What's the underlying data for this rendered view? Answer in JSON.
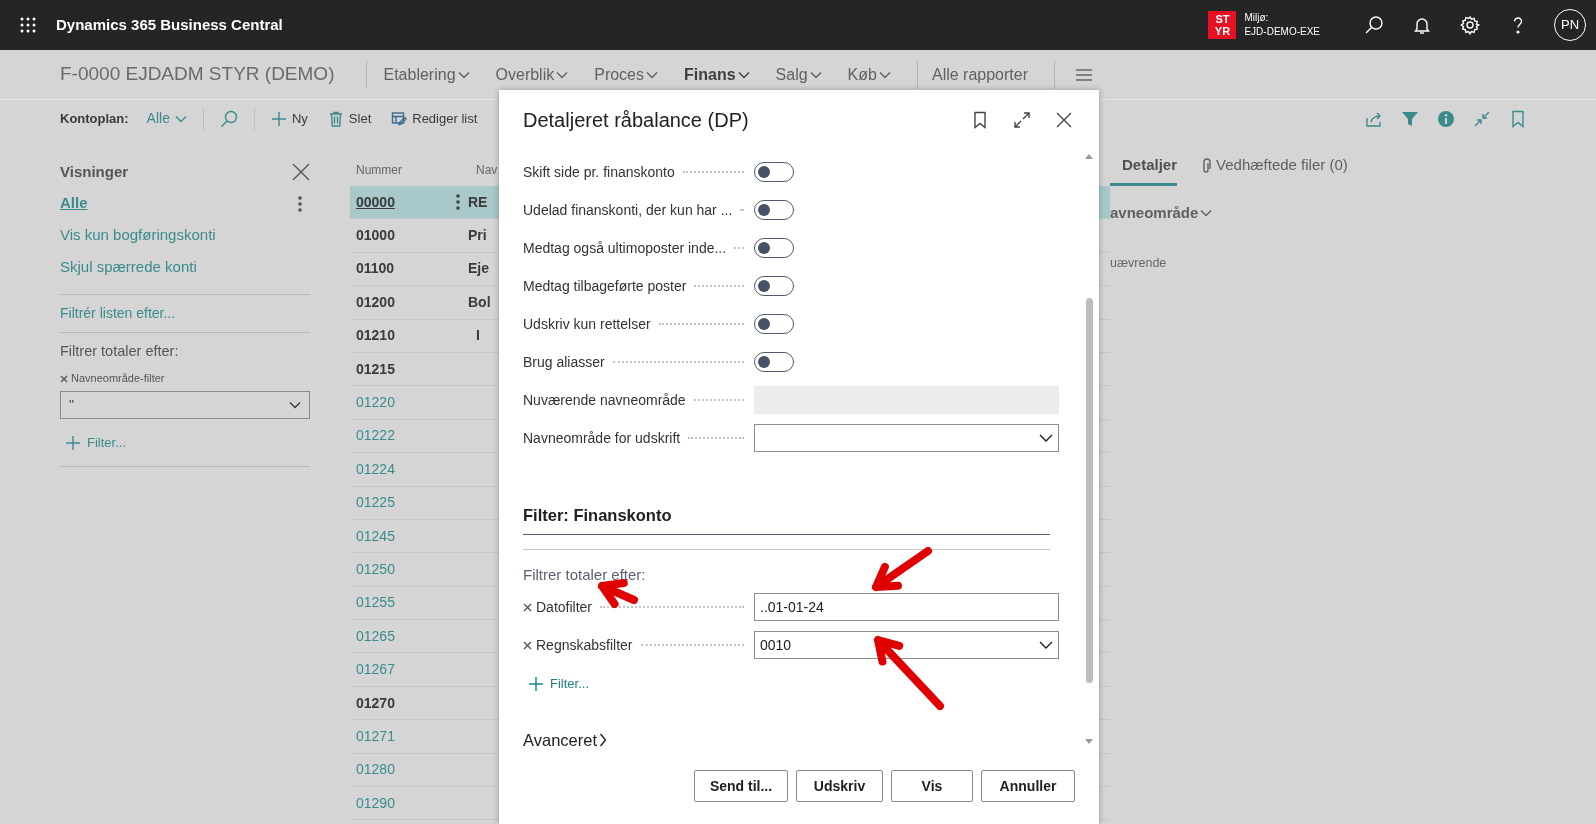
{
  "app_bar": {
    "title": "Dynamics 365 Business Central",
    "environment": {
      "badge": "ST YR",
      "label": "Miljø:",
      "name": "EJD-DEMO-EXE"
    },
    "avatar": "PN"
  },
  "page": {
    "title": "F-0000 EJDADM STYR (DEMO)",
    "nav": [
      {
        "label": "Etablering",
        "selected": false,
        "kind": "menu"
      },
      {
        "label": "Overblik",
        "selected": false,
        "kind": "menu"
      },
      {
        "label": "Proces",
        "selected": false,
        "kind": "menu"
      },
      {
        "label": "Finans",
        "selected": true,
        "kind": "menu"
      },
      {
        "label": "Salg",
        "selected": false,
        "kind": "menu"
      },
      {
        "label": "Køb",
        "selected": false,
        "kind": "menu"
      },
      {
        "label": "Alle rapporter",
        "selected": false,
        "kind": "link"
      }
    ]
  },
  "action_bar": {
    "view_label": "Kontoplan:",
    "view_value": "Alle",
    "actions": [
      {
        "label": "Ny",
        "kind": "add"
      },
      {
        "label": "Slet",
        "kind": "delete"
      },
      {
        "label": "Rediger list",
        "kind": "edit"
      }
    ]
  },
  "views_panel": {
    "title": "Visninger",
    "views": [
      {
        "label": "Alle",
        "selected": true
      },
      {
        "label": "Vis kun bogføringskonti",
        "selected": false
      },
      {
        "label": "Skjul spærrede konti",
        "selected": false
      }
    ],
    "filter_list_link": "Filtrér listen efter...",
    "totals_label": "Filtrer totaler efter:",
    "totals_filters": [
      {
        "label": "Navneområde-filter",
        "value": "''"
      }
    ],
    "add_filter": "Filter..."
  },
  "list": {
    "columns": [
      "Nummer",
      "Nav"
    ],
    "rows": [
      {
        "number": "00000",
        "name": "RE",
        "kind": "heading",
        "selected": true
      },
      {
        "number": "01000",
        "name": "Pri",
        "kind": "heading",
        "selected": false
      },
      {
        "number": "01100",
        "name": "Eje",
        "kind": "heading",
        "selected": false
      },
      {
        "number": "01200",
        "name": "Bol",
        "kind": "heading",
        "selected": false
      },
      {
        "number": "01210",
        "name": "I",
        "kind": "heading",
        "selected": false
      },
      {
        "number": "01215",
        "kind": "heading",
        "selected": false
      },
      {
        "number": "01220",
        "kind": "posting",
        "selected": false
      },
      {
        "number": "01222",
        "kind": "posting",
        "selected": false
      },
      {
        "number": "01224",
        "kind": "posting",
        "selected": false
      },
      {
        "number": "01225",
        "kind": "posting",
        "selected": false
      },
      {
        "number": "01245",
        "kind": "posting",
        "selected": false
      },
      {
        "number": "01250",
        "kind": "posting",
        "selected": false
      },
      {
        "number": "01255",
        "kind": "posting",
        "selected": false
      },
      {
        "number": "01265",
        "kind": "posting",
        "selected": false
      },
      {
        "number": "01267",
        "kind": "posting",
        "selected": false
      },
      {
        "number": "01270",
        "kind": "heading",
        "selected": false
      },
      {
        "number": "01271",
        "kind": "posting",
        "selected": false
      },
      {
        "number": "01280",
        "kind": "posting",
        "selected": false
      },
      {
        "number": "01290",
        "kind": "posting",
        "selected": false
      }
    ]
  },
  "details_panel": {
    "tabs": [
      {
        "label": "Detaljer",
        "selected": true
      },
      {
        "label": "Vedhæftede filer (0)",
        "selected": false
      }
    ],
    "group": "avneområde",
    "field_label": "uævrende"
  },
  "dialog": {
    "title": "Detaljeret råbalance (DP)",
    "options": [
      {
        "kind": "toggle",
        "label": "Skift side pr. finanskonto",
        "on": false
      },
      {
        "kind": "toggle",
        "label": "Udelad finanskonti, der kun har ...",
        "on": false
      },
      {
        "kind": "toggle",
        "label": "Medtag også ultimoposter inde...",
        "on": false
      },
      {
        "kind": "toggle",
        "label": "Medtag tilbageførte poster",
        "on": false
      },
      {
        "kind": "toggle",
        "label": "Udskriv kun rettelser",
        "on": false
      },
      {
        "kind": "toggle",
        "label": "Brug aliasser",
        "on": false
      },
      {
        "kind": "readonly",
        "label": "Nuværende navneområde"
      },
      {
        "kind": "dropdown",
        "label": "Navneområde for udskrift"
      }
    ],
    "filter_section": {
      "title": "Filter: Finanskonto",
      "totals_label": "Filtrer totaler efter:",
      "filters": [
        {
          "label": "Datofilter",
          "value": "..01-01-24",
          "kind": "text"
        },
        {
          "label": "Regnskabsfilter",
          "value": "0010",
          "kind": "dropdown"
        }
      ],
      "add_filter": "Filter..."
    },
    "advanced": {
      "title": "Avanceret",
      "expanded": false
    },
    "buttons": [
      "Send til...",
      "Udskriv",
      "Vis",
      "Annuller"
    ]
  }
}
